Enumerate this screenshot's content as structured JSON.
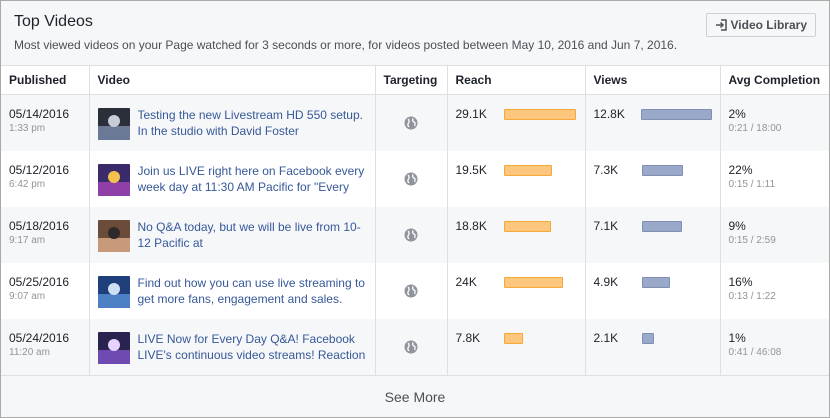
{
  "header": {
    "title": "Top Videos",
    "subtitle": "Most viewed videos on your Page watched for 3 seconds or more, for videos posted between May 10, 2016 and Jun 7, 2016.",
    "library_button": "Video Library",
    "library_icon": "enter-library-icon"
  },
  "columns": {
    "published": "Published",
    "video": "Video",
    "targeting": "Targeting",
    "reach": "Reach",
    "views": "Views",
    "completion": "Avg Completion"
  },
  "colors": {
    "reach_bar": "#fcc77c",
    "views_bar": "#9aa9c9",
    "link": "#365899"
  },
  "rows": [
    {
      "date": "05/14/2016",
      "time": "1:33 pm",
      "title": "Testing the new Livestream HD 550 setup. In the studio with David Foster",
      "thumb_icon": "video-thumbnail-icon",
      "targeting_icon": "globe-icon",
      "reach": "29.1K",
      "reach_value": 29100,
      "views": "12.8K",
      "views_value": 12800,
      "completion": "2%",
      "duration": "0:21 / 18:00"
    },
    {
      "date": "05/12/2016",
      "time": "6:42 pm",
      "title": "Join us LIVE right here on Facebook every week day at 11:30 AM Pacific for \"Every",
      "thumb_icon": "video-thumbnail-icon",
      "targeting_icon": "globe-icon",
      "reach": "19.5K",
      "reach_value": 19500,
      "views": "7.3K",
      "views_value": 7300,
      "completion": "22%",
      "duration": "0:15 / 1:11"
    },
    {
      "date": "05/18/2016",
      "time": "9:17 am",
      "title": "No Q&A today, but we will be live from 10-12 Pacific at",
      "thumb_icon": "video-thumbnail-icon",
      "targeting_icon": "globe-icon",
      "reach": "18.8K",
      "reach_value": 18800,
      "views": "7.1K",
      "views_value": 7100,
      "completion": "9%",
      "duration": "0:15 / 2:59"
    },
    {
      "date": "05/25/2016",
      "time": "9:07 am",
      "title": "Find out how you can use live streaming to get more fans, engagement and sales.",
      "thumb_icon": "video-thumbnail-icon",
      "targeting_icon": "globe-icon",
      "reach": "24K",
      "reach_value": 24000,
      "views": "4.9K",
      "views_value": 4900,
      "completion": "16%",
      "duration": "0:13 / 1:22"
    },
    {
      "date": "05/24/2016",
      "time": "11:20 am",
      "title": "LIVE Now for Every Day Q&A! Facebook LIVE's continuous video streams! Reaction",
      "thumb_icon": "video-thumbnail-icon",
      "targeting_icon": "globe-icon",
      "reach": "7.8K",
      "reach_value": 7800,
      "views": "2.1K",
      "views_value": 2100,
      "completion": "1%",
      "duration": "0:41 / 46:08"
    }
  ],
  "footer": {
    "see_more": "See More"
  }
}
